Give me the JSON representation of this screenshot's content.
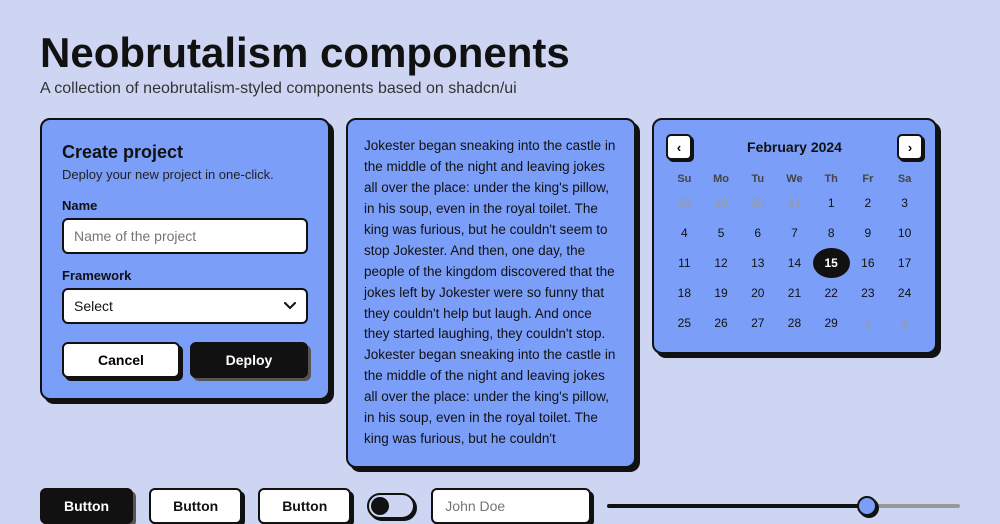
{
  "page": {
    "title": "Neobrutalism components",
    "subtitle": "A collection of neobrutalism-styled components based on shadcn/ui"
  },
  "create_project_card": {
    "title": "Create project",
    "subtitle": "Deploy your new project in one-click.",
    "name_label": "Name",
    "name_placeholder": "Name of the project",
    "framework_label": "Framework",
    "framework_placeholder": "Select",
    "cancel_label": "Cancel",
    "deploy_label": "Deploy"
  },
  "text_card": {
    "content": "Jokester began sneaking into the castle in the middle of the night and leaving jokes all over the place: under the king's pillow, in his soup, even in the royal toilet. The king was furious, but he couldn't seem to stop Jokester. And then, one day, the people of the kingdom discovered that the jokes left by Jokester were so funny that they couldn't help but laugh. And once they started laughing, they couldn't stop. Jokester began sneaking into the castle in the middle of the night and leaving jokes all over the place: under the king's pillow, in his soup, even in the royal toilet. The king was furious, but he couldn't"
  },
  "calendar": {
    "month_year": "February 2024",
    "prev_icon": "‹",
    "next_icon": "›",
    "days_of_week": [
      "Su",
      "Mo",
      "Tu",
      "We",
      "Th",
      "Fr",
      "Sa"
    ],
    "weeks": [
      [
        {
          "day": "28",
          "outside": true
        },
        {
          "day": "29",
          "outside": true
        },
        {
          "day": "30",
          "outside": true
        },
        {
          "day": "31",
          "outside": true
        },
        {
          "day": "1"
        },
        {
          "day": "2"
        },
        {
          "day": "3"
        }
      ],
      [
        {
          "day": "4"
        },
        {
          "day": "5"
        },
        {
          "day": "6"
        },
        {
          "day": "7"
        },
        {
          "day": "8"
        },
        {
          "day": "9"
        },
        {
          "day": "10"
        }
      ],
      [
        {
          "day": "11"
        },
        {
          "day": "12"
        },
        {
          "day": "13"
        },
        {
          "day": "14"
        },
        {
          "day": "15",
          "today": true
        },
        {
          "day": "16"
        },
        {
          "day": "17"
        }
      ],
      [
        {
          "day": "18"
        },
        {
          "day": "19"
        },
        {
          "day": "20"
        },
        {
          "day": "21"
        },
        {
          "day": "22"
        },
        {
          "day": "23"
        },
        {
          "day": "24"
        }
      ],
      [
        {
          "day": "25"
        },
        {
          "day": "26"
        },
        {
          "day": "27"
        },
        {
          "day": "28"
        },
        {
          "day": "29"
        },
        {
          "day": "1",
          "outside": true
        },
        {
          "day": "2",
          "outside": true
        }
      ]
    ]
  },
  "bottom_row": {
    "button1_label": "Button",
    "button2_label": "Button",
    "button3_label": "Button",
    "text_input_value": "John Doe",
    "text_input_placeholder": "John Doe",
    "slider_value": 75
  }
}
